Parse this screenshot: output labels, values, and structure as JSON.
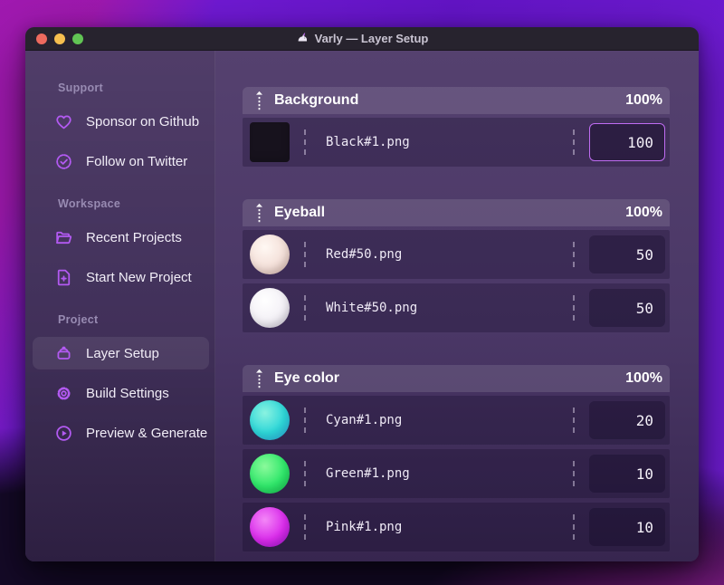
{
  "window": {
    "title": "Varly — Layer Setup",
    "traffic_lights": {
      "close": "red",
      "minimize": "yellow",
      "zoom": "green"
    }
  },
  "sidebar": {
    "sections": [
      {
        "label": "Support",
        "items": [
          {
            "label": "Sponsor on Github",
            "icon": "heart-icon"
          },
          {
            "label": "Follow on Twitter",
            "icon": "badge-check-icon"
          }
        ]
      },
      {
        "label": "Workspace",
        "items": [
          {
            "label": "Recent Projects",
            "icon": "folder-open-icon"
          },
          {
            "label": "Start New Project",
            "icon": "file-plus-icon"
          }
        ]
      },
      {
        "label": "Project",
        "items": [
          {
            "label": "Layer Setup",
            "icon": "layers-basket-icon",
            "selected": true
          },
          {
            "label": "Build Settings",
            "icon": "gear-icon"
          },
          {
            "label": "Preview & Generate",
            "icon": "play-circle-icon"
          }
        ]
      }
    ]
  },
  "main": {
    "groups": [
      {
        "name": "Background",
        "percent": "100%",
        "rows": [
          {
            "file": "Black#1.png",
            "value": "100",
            "thumb": "black",
            "focused": true
          }
        ]
      },
      {
        "name": "Eyeball",
        "percent": "100%",
        "rows": [
          {
            "file": "Red#50.png",
            "value": "50",
            "thumb": "pearl"
          },
          {
            "file": "White#50.png",
            "value": "50",
            "thumb": "white"
          }
        ]
      },
      {
        "name": "Eye color",
        "percent": "100%",
        "rows": [
          {
            "file": "Cyan#1.png",
            "value": "20",
            "thumb": "cyan"
          },
          {
            "file": "Green#1.png",
            "value": "10",
            "thumb": "green"
          },
          {
            "file": "Pink#1.png",
            "value": "10",
            "thumb": "pink"
          }
        ]
      }
    ]
  },
  "thumbs": {
    "black": {
      "hex": "#17121d",
      "shape": "square"
    },
    "pearl": {
      "stops": [
        "#fff8f3",
        "#f4e0d9 55%",
        "#d8b6ac"
      ]
    },
    "white": {
      "stops": [
        "#ffffff",
        "#f3f0f6 58%",
        "#cdc6d6"
      ]
    },
    "cyan": {
      "stops": [
        "#8af2e0",
        "#2dd6d8 55%",
        "#2fb0ec"
      ]
    },
    "green": {
      "stops": [
        "#8bfa9b",
        "#2fe76a 55%",
        "#17c653"
      ]
    },
    "pink": {
      "stops": [
        "#f387f7",
        "#da2ceb 55%",
        "#a514d6"
      ]
    }
  },
  "colors": {
    "accent_purple": "#b35af2",
    "focus_border": "#bf6cf2",
    "titlebar_bg": "#27232e",
    "traffic_red": "#ed6a5e",
    "traffic_yellow": "#f5bf4f",
    "traffic_green": "#61c454"
  }
}
